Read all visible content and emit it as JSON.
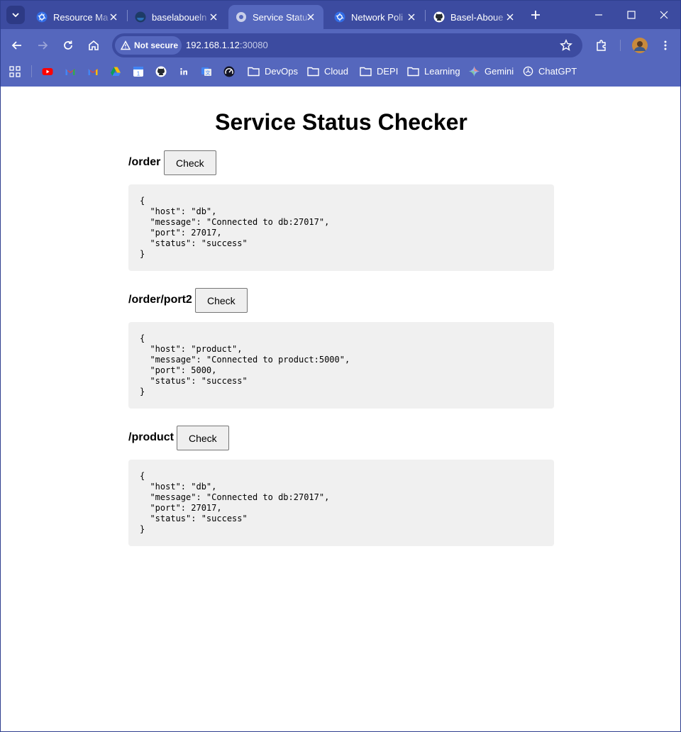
{
  "browser": {
    "tabs": [
      {
        "label": "Resource Ma",
        "icon": "kubernetes-icon",
        "active": false
      },
      {
        "label": "baselaboueln",
        "icon": "dockerhub-icon",
        "active": false
      },
      {
        "label": "Service Statu",
        "icon": "globe-icon",
        "active": true
      },
      {
        "label": "Network Poli",
        "icon": "kubernetes-icon",
        "active": false
      },
      {
        "label": "Basel-Aboue",
        "icon": "github-icon",
        "active": false
      }
    ],
    "address": {
      "security_label": "Not secure",
      "host": "192.168.1.12",
      "port": ":30080"
    },
    "bookmarks": [
      {
        "label": "DevOps",
        "icon": "folder-icon"
      },
      {
        "label": "Cloud",
        "icon": "folder-icon"
      },
      {
        "label": "DEPI",
        "icon": "folder-icon"
      },
      {
        "label": "Learning",
        "icon": "folder-icon"
      },
      {
        "label": "Gemini",
        "icon": "gemini-icon"
      },
      {
        "label": "ChatGPT",
        "icon": "chatgpt-icon"
      }
    ],
    "colors": {
      "frame": "#3c4ba0",
      "toolbar": "#5567bd",
      "active_tab": "#5567bd"
    }
  },
  "page": {
    "title": "Service Status Checker",
    "endpoints": [
      {
        "path": "/order",
        "button": "Check",
        "response": "{\n  \"host\": \"db\",\n  \"message\": \"Connected to db:27017\",\n  \"port\": 27017,\n  \"status\": \"success\"\n}"
      },
      {
        "path": "/order/port2",
        "button": "Check",
        "response": "{\n  \"host\": \"product\",\n  \"message\": \"Connected to product:5000\",\n  \"port\": 5000,\n  \"status\": \"success\"\n}"
      },
      {
        "path": "/product",
        "button": "Check",
        "response": "{\n  \"host\": \"db\",\n  \"message\": \"Connected to db:27017\",\n  \"port\": 27017,\n  \"status\": \"success\"\n}"
      }
    ]
  }
}
